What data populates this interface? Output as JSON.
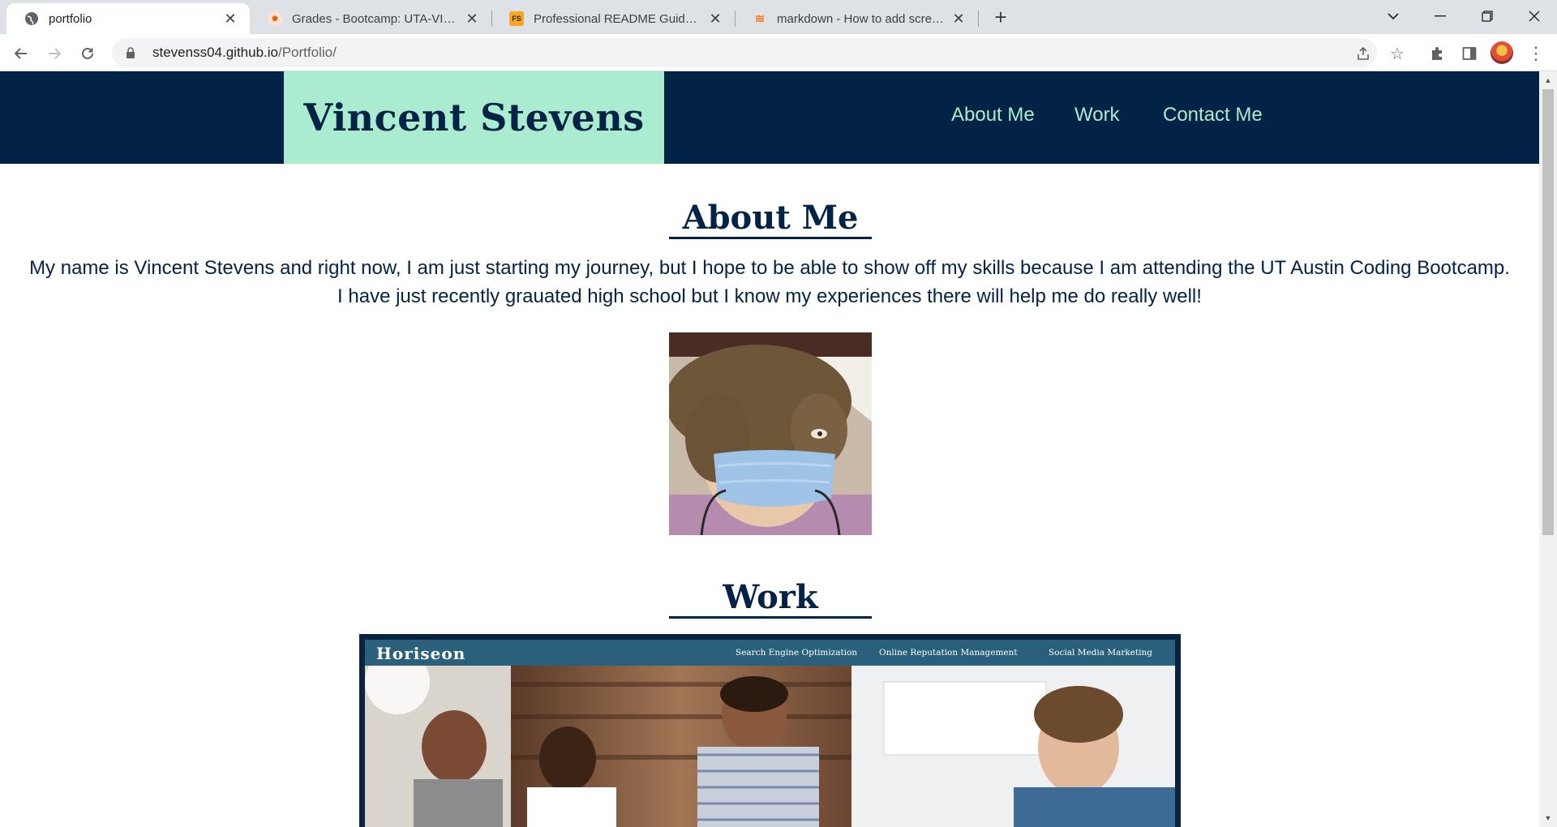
{
  "browser": {
    "tabs": [
      {
        "title": "portfolio",
        "active": true
      },
      {
        "title": "Grades - Bootcamp: UTA-VIRT-FS",
        "active": false
      },
      {
        "title": "Professional README Guide | The",
        "active": false
      },
      {
        "title": "markdown - How to add screensh",
        "active": false
      }
    ],
    "url_host": "stevenss04.github.io",
    "url_path": "/Portfolio/"
  },
  "site": {
    "brand": "Vincent Stevens",
    "nav": [
      {
        "label": "About Me"
      },
      {
        "label": "Work"
      },
      {
        "label": "Contact Me"
      }
    ],
    "colors": {
      "header_bg": "#022346",
      "brand_bg": "#a9eccf",
      "nav_text": "#a9eccf"
    }
  },
  "about": {
    "heading": "About Me",
    "body": "My name is Vincent Stevens and right now, I am just starting my journey, but I hope to be able to show off my skills because I am attending the UT Austin Coding Bootcamp. I have just recently grauated high school but I know my experiences there will help me do really well!",
    "photo_icon": "profile-photo"
  },
  "work": {
    "heading": "Work",
    "project": {
      "logo": "Horiseon",
      "links": [
        "Search Engine Optimization",
        "Online Reputation Management",
        "Social Media Marketing"
      ]
    }
  }
}
